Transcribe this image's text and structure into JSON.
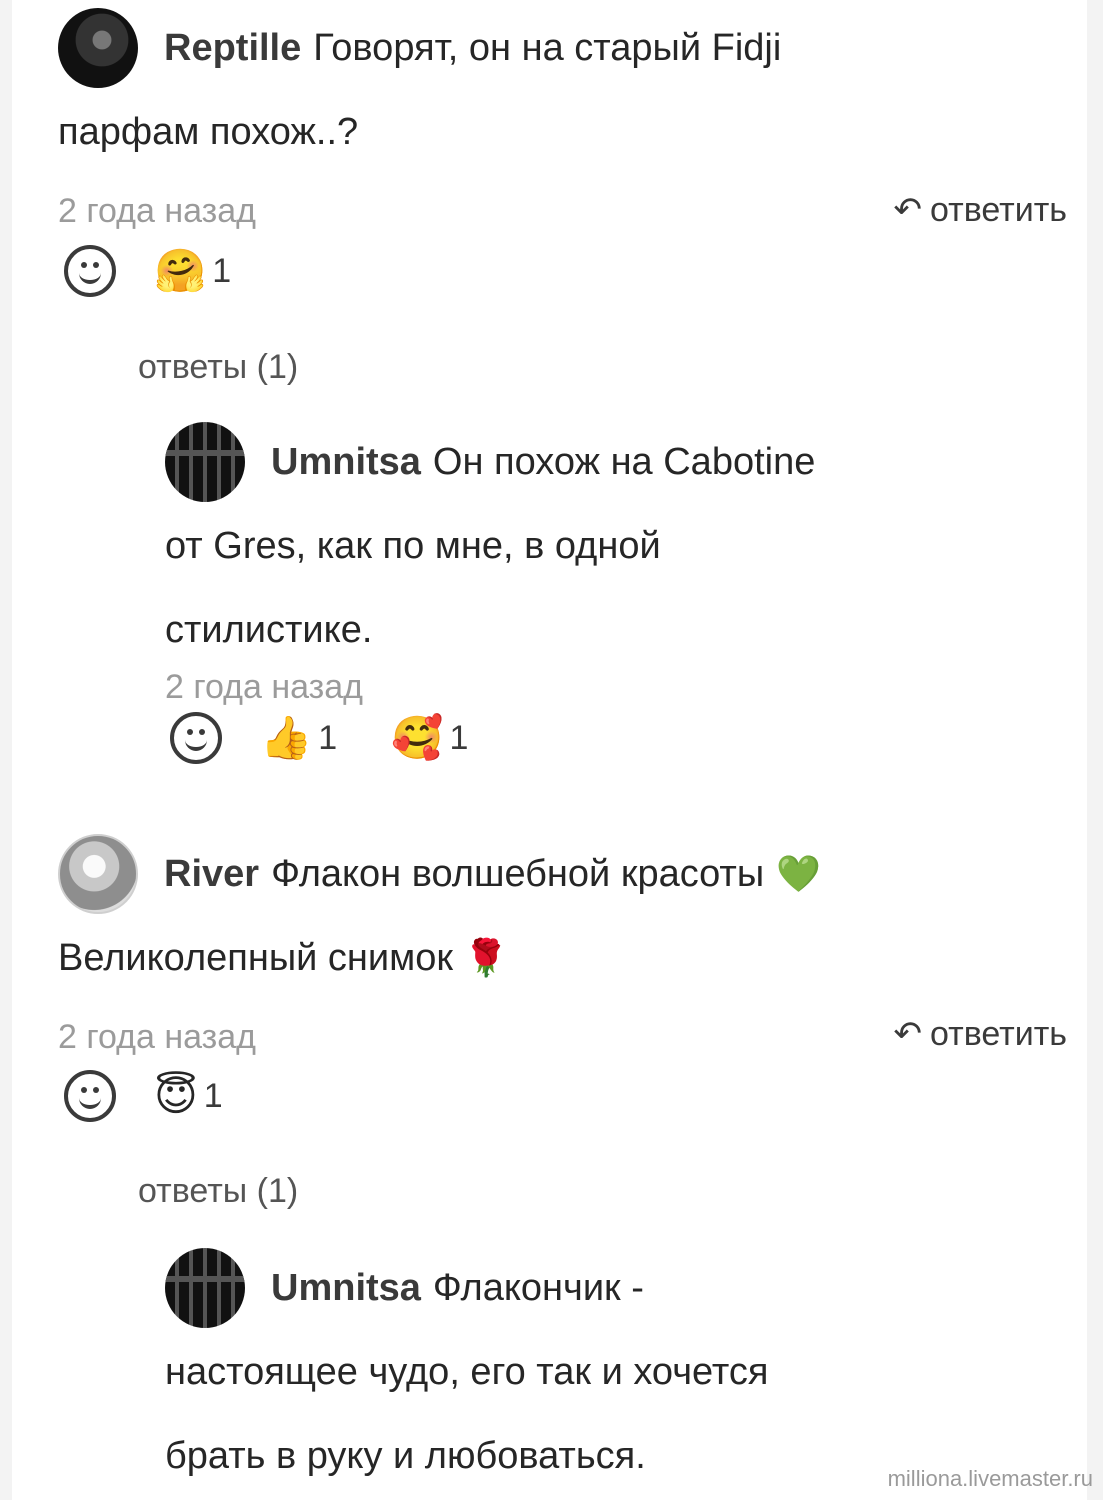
{
  "comments": [
    {
      "username": "Reptille",
      "text_line1": "Говорят, он на старый Fidji",
      "text_line2": "парфам похож..?",
      "time": "2 года назад",
      "reply_label": "ответить",
      "reactions": [
        {
          "emoji": "🤗",
          "count": "1"
        }
      ],
      "replies_label": "ответы (1)",
      "reply": {
        "username": "Umnitsa",
        "text_line1": "Он похож на Cabotine",
        "text_line2": "от Gres, как по мне, в одной",
        "text_line3": "стилистике.",
        "time": "2 года назад",
        "reactions": [
          {
            "emoji": "👍",
            "count": "1"
          },
          {
            "emoji": "🥰",
            "count": "1"
          }
        ]
      }
    },
    {
      "username": "River",
      "text_line1": "Флакон волшебной красоты",
      "emoji1": "💚",
      "text_line2": "Великолепный снимок",
      "emoji2": "🌹",
      "time": "2 года назад",
      "reply_label": "ответить",
      "reactions": [
        {
          "emoji": "😇",
          "count": "1"
        }
      ],
      "replies_label": "ответы (1)",
      "reply": {
        "username": "Umnitsa",
        "text_line1": "Флакончик -",
        "text_line2": "настоящее чудо, его так и хочется",
        "text_line3": "брать в руку и любоваться."
      }
    }
  ],
  "watermark": "milliona.livemaster.ru"
}
